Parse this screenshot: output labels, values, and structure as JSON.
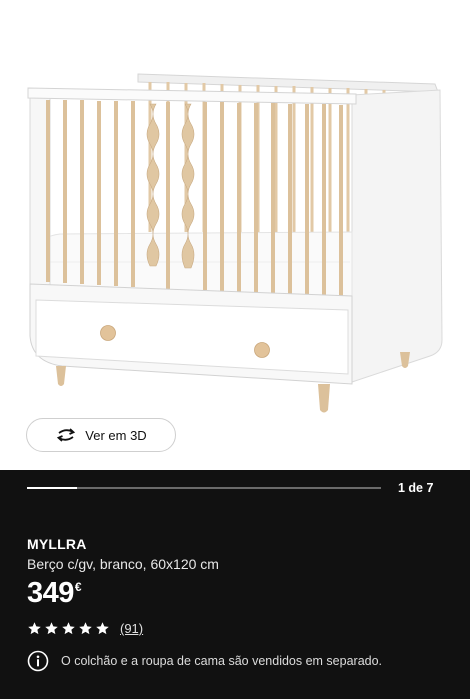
{
  "product": {
    "name": "MYLLRA",
    "description": "Berço c/gv, branco, 60x120 cm",
    "price_amount": "349",
    "price_currency": "€",
    "rating_stars": 5,
    "rating_count": "(91)",
    "notice": "O colchão e a roupa de cama são vendidos em separado."
  },
  "gallery": {
    "counter": "1 de 7",
    "progress_fraction": 0.14,
    "view3d_label": "Ver em 3D"
  },
  "colors": {
    "panel_bg": "#111111",
    "crib_white": "#f5f5f5",
    "wood": "#e2c9a6"
  },
  "icons": [
    "rotate-3d-icon",
    "star-icon",
    "info-icon"
  ]
}
